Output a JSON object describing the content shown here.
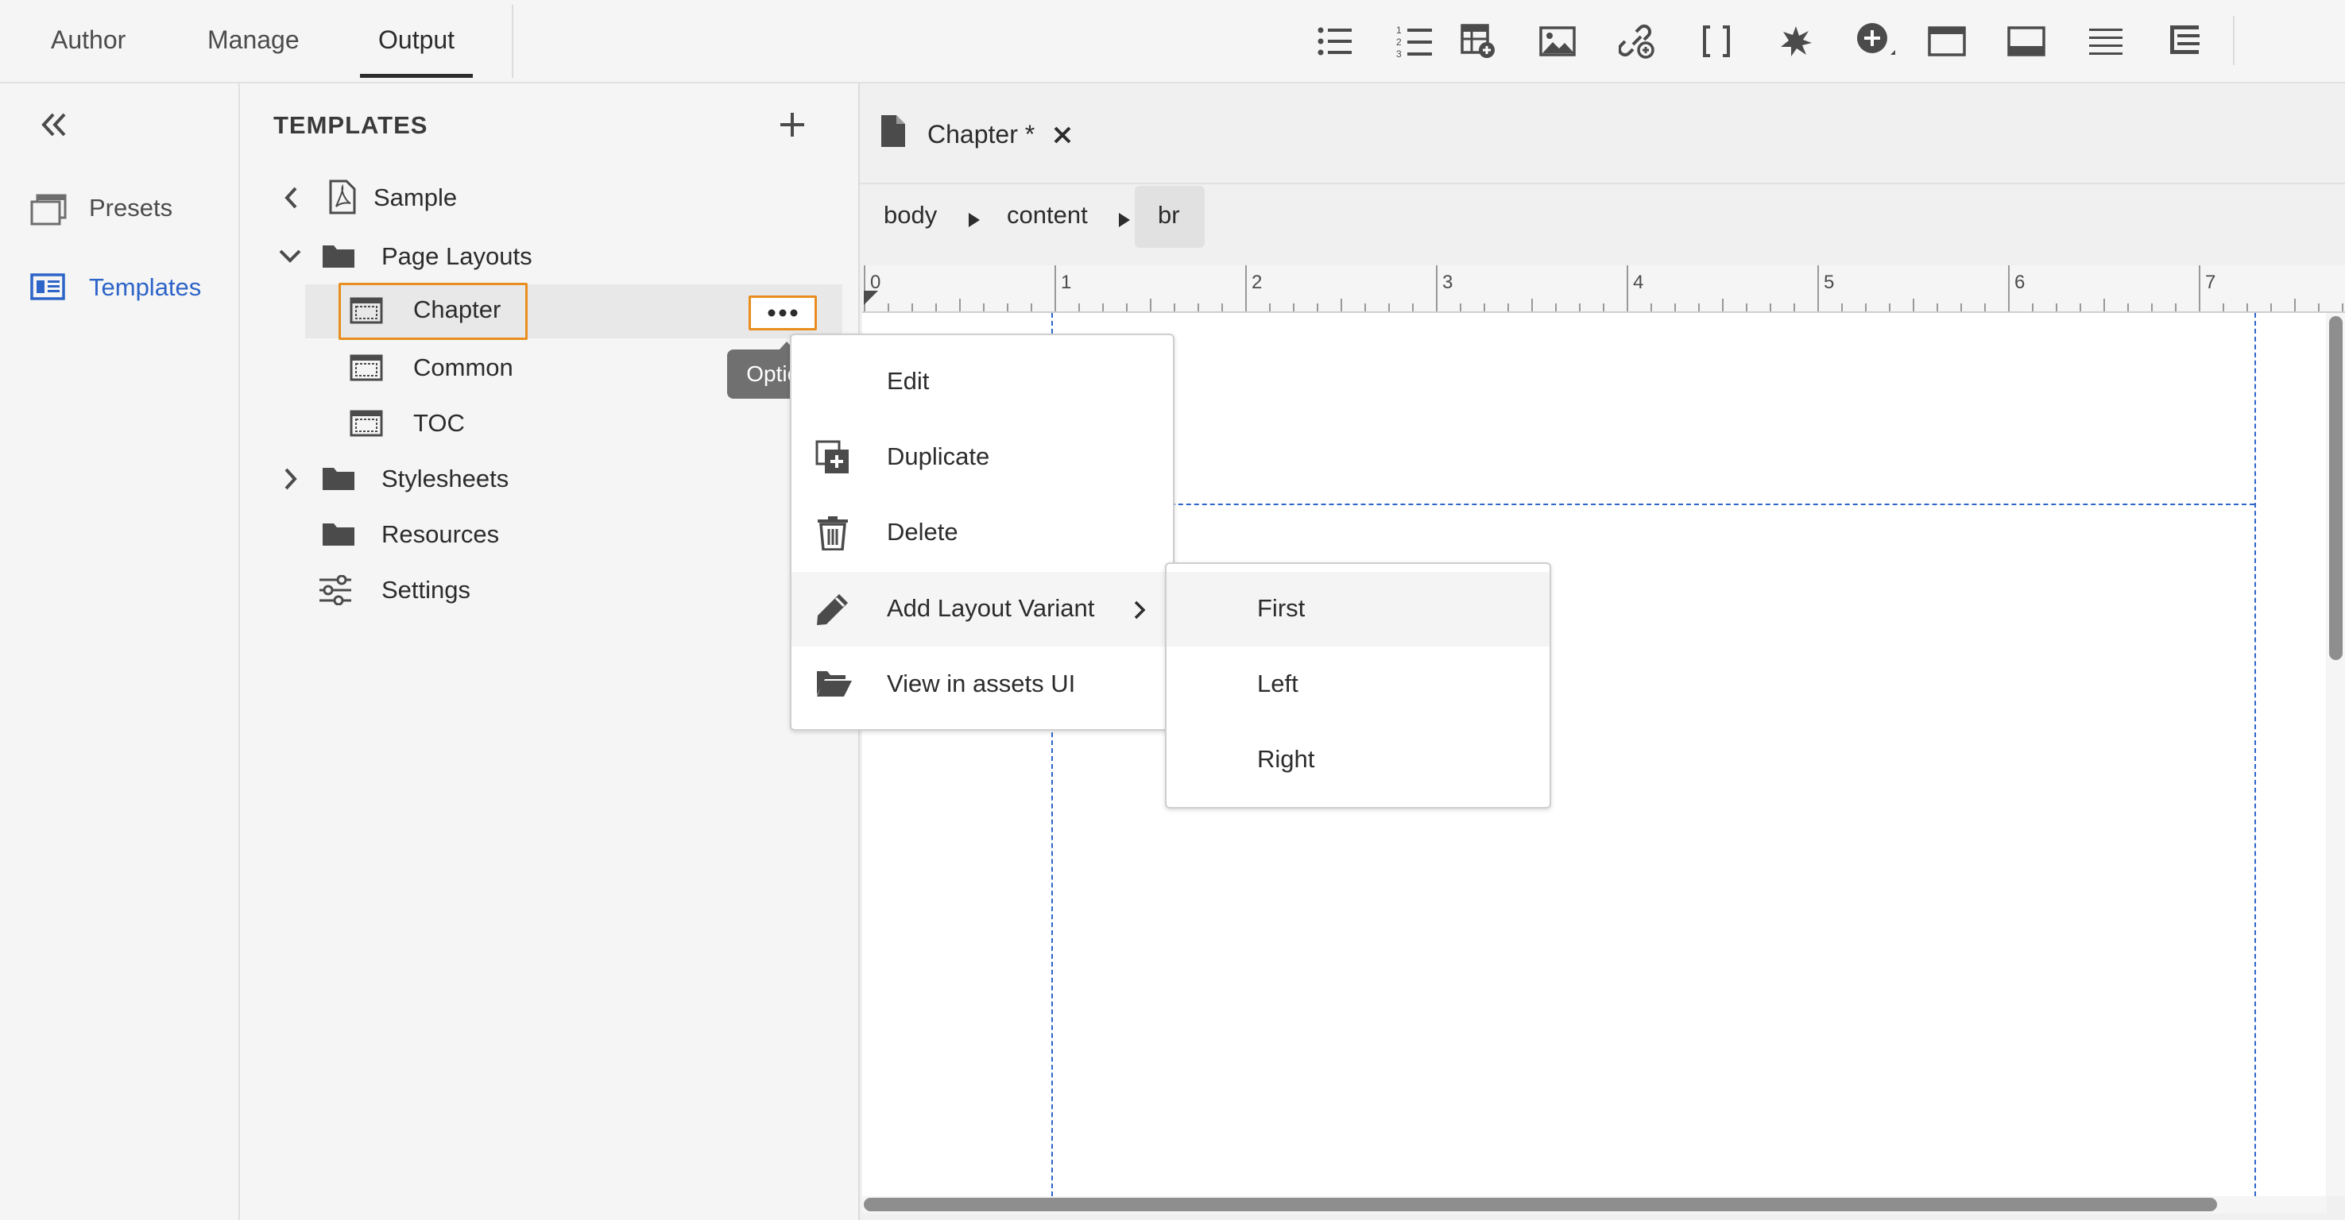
{
  "top_tabs": {
    "author": "Author",
    "manage": "Manage",
    "output": "Output",
    "selected": "Output"
  },
  "toolbar": {
    "icons": [
      "bulleted-list-icon",
      "numbered-list-icon",
      "insert-table-icon",
      "insert-image-icon",
      "insert-link-icon",
      "brackets-icon",
      "starburst-icon",
      "add-circle-icon",
      "window-icon",
      "footer-layout-icon",
      "lines-icon",
      "align-list-icon"
    ]
  },
  "left_rail": {
    "items": [
      {
        "label": "Presets",
        "icon": "presets-icon",
        "selected": false
      },
      {
        "label": "Templates",
        "icon": "templates-icon",
        "selected": true
      }
    ]
  },
  "templates_panel": {
    "title": "TEMPLATES",
    "tree": {
      "sample": "Sample",
      "page_layouts": "Page Layouts",
      "chapter": "Chapter",
      "common": "Common",
      "toc": "TOC",
      "stylesheets": "Stylesheets",
      "resources": "Resources",
      "settings": "Settings"
    }
  },
  "tooltip": "Options",
  "context_menu": {
    "items": [
      "Edit",
      "Duplicate",
      "Delete",
      "Add Layout Variant",
      "View in assets UI"
    ]
  },
  "submenu": {
    "items": [
      "First",
      "Left",
      "Right"
    ],
    "highlighted": "First"
  },
  "editor": {
    "tab_title": "Chapter *",
    "breadcrumb": [
      "body",
      "content",
      "br"
    ],
    "ruler_labels": [
      "0",
      "1",
      "2",
      "3",
      "4",
      "5",
      "6",
      "7"
    ]
  },
  "colors": {
    "accent_blue": "#2d64c8",
    "highlight_orange": "#e88d1e",
    "tooltip_gray": "#707070"
  }
}
